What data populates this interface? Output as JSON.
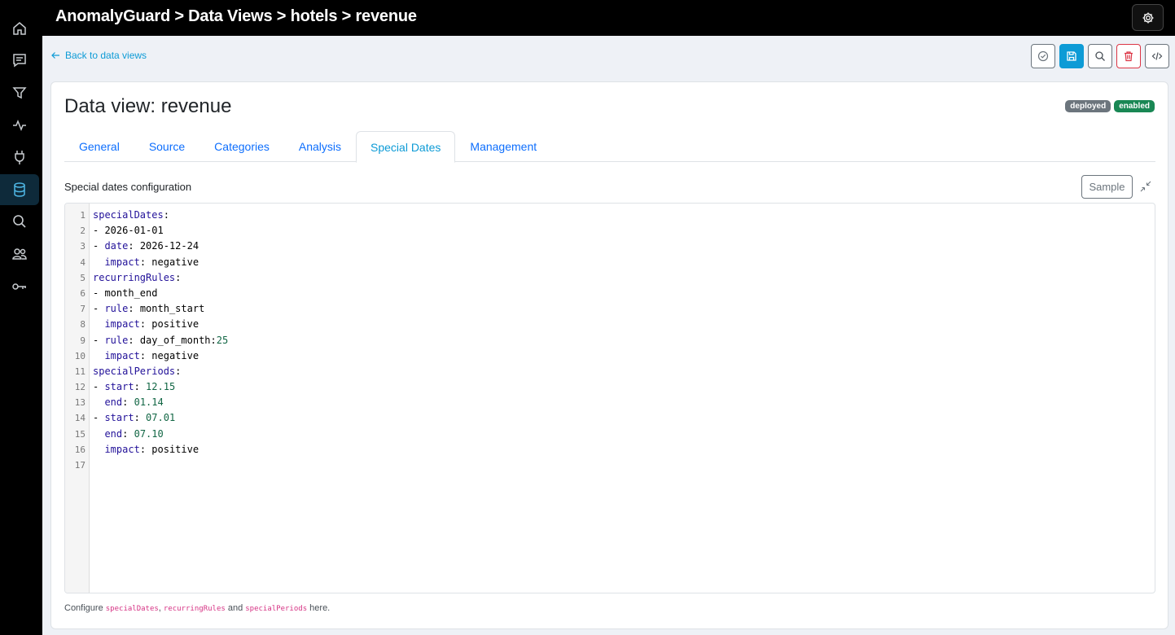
{
  "app": {
    "breadcrumb": "AnomalyGuard > Data Views > hotels > revenue"
  },
  "sidebar": {
    "items": [
      {
        "icon": "home-icon"
      },
      {
        "icon": "chat-icon"
      },
      {
        "icon": "filter-icon"
      },
      {
        "icon": "pulse-icon"
      },
      {
        "icon": "plug-icon"
      },
      {
        "icon": "database-icon",
        "active": true
      },
      {
        "icon": "search-icon"
      },
      {
        "icon": "users-icon"
      },
      {
        "icon": "key-icon"
      }
    ]
  },
  "nav": {
    "back_label": "Back to data views"
  },
  "toolbar": {
    "buttons": [
      "validate-icon",
      "save-icon",
      "search-icon",
      "trash-icon",
      "code-icon"
    ]
  },
  "page": {
    "title": "Data view: revenue",
    "badges": [
      "deployed",
      "enabled"
    ]
  },
  "tabs": [
    "General",
    "Source",
    "Categories",
    "Analysis",
    "Special Dates",
    "Management"
  ],
  "active_tab": "Special Dates",
  "section": {
    "label": "Special dates configuration",
    "sample_label": "Sample"
  },
  "editor": {
    "lines": [
      "specialDates:",
      "- 2026-01-01",
      "- date: 2026-12-24",
      "  impact: negative",
      "recurringRules:",
      "- month_end",
      "- rule: month_start",
      "  impact: positive",
      "- rule: day_of_month:25",
      "  impact: negative",
      "specialPeriods:",
      "- start: 12.15",
      "  end: 01.14",
      "- start: 07.01",
      "  end: 07.10",
      "  impact: positive",
      ""
    ]
  },
  "hint": {
    "prefix": "Configure ",
    "code1": "specialDates",
    "sep1": ", ",
    "code2": "recurringRules",
    "sep2": " and ",
    "code3": "specialPeriods",
    "suffix": " here."
  },
  "colors": {
    "accent": "#0d9bd6",
    "danger": "#dc3545",
    "badge_deployed": "#6c757d",
    "badge_enabled": "#198754"
  }
}
